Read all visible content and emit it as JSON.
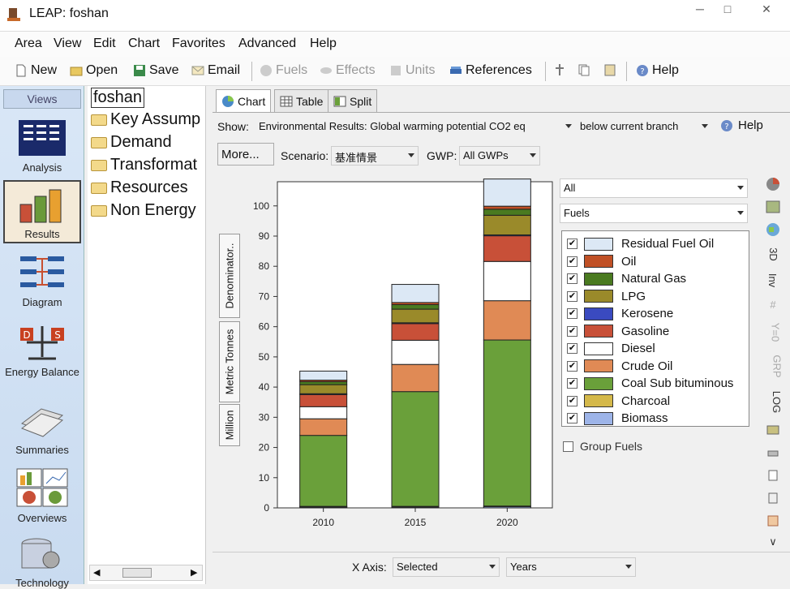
{
  "window": {
    "title": "LEAP: foshan"
  },
  "menu": [
    "Area",
    "View",
    "Edit",
    "Chart",
    "Favorites",
    "Advanced",
    "Help"
  ],
  "toolbar": {
    "new": "New",
    "open": "Open",
    "save": "Save",
    "email": "Email",
    "fuels": "Fuels",
    "effects": "Effects",
    "units": "Units",
    "references": "References",
    "help": "Help"
  },
  "views": {
    "header": "Views",
    "items": [
      "Analysis",
      "Results",
      "Diagram",
      "Energy Balance",
      "Summaries",
      "Overviews",
      "Technology"
    ]
  },
  "tree": {
    "root": "foshan",
    "items": [
      "Key Assump",
      "Demand",
      "Transformat",
      "Resources",
      "Non Energy"
    ]
  },
  "tabs": [
    "Chart",
    "Table",
    "Split"
  ],
  "controls": {
    "show_label": "Show:",
    "show_value": "Environmental Results: Global warming potential CO2 eq",
    "branch_value": "below current branch",
    "help": "Help",
    "more": "More...",
    "scenario_label": "Scenario:",
    "scenario_value": "基准情景",
    "gwp_label": "GWP:",
    "gwp_value": "All GWPs",
    "filter1": "All",
    "filter2": "Fuels",
    "group_fuels": "Group Fuels",
    "xaxis_label": "X Axis:",
    "xaxis_value": "Selected",
    "xaxis_dim": "Years"
  },
  "side_tabs": [
    "Denominator..",
    "Metric Tonnes",
    "Million"
  ],
  "right_tools": [
    "3D",
    "Inv",
    "Y=0",
    "GRP",
    "LOG"
  ],
  "chart_data": {
    "type": "bar",
    "stacked": true,
    "categories": [
      "2010",
      "2015",
      "2020"
    ],
    "ylim": [
      0,
      108
    ],
    "yticks": [
      0,
      10,
      20,
      30,
      40,
      50,
      60,
      70,
      80,
      90,
      100
    ],
    "series": [
      {
        "name": "Biomass",
        "color": "#9db4e8",
        "values": [
          0.3,
          0.3,
          0.4
        ]
      },
      {
        "name": "Charcoal",
        "color": "#d4b84a",
        "values": [
          0.2,
          0.2,
          0.2
        ]
      },
      {
        "name": "Coal Sub bituminous",
        "color": "#6aa03a",
        "values": [
          23.5,
          38.0,
          55.0
        ]
      },
      {
        "name": "Crude Oil",
        "color": "#e08a55",
        "values": [
          5.5,
          9.0,
          13.0
        ]
      },
      {
        "name": "Diesel",
        "color": "#ffffff",
        "values": [
          4.0,
          8.0,
          13.0
        ]
      },
      {
        "name": "Gasoline",
        "color": "#c85038",
        "values": [
          4.0,
          5.5,
          8.5
        ]
      },
      {
        "name": "Kerosene",
        "color": "#3a4ac0",
        "values": [
          0.3,
          0.3,
          0.3
        ]
      },
      {
        "name": "LPG",
        "color": "#9a8a2a",
        "values": [
          3.0,
          4.5,
          6.5
        ]
      },
      {
        "name": "Natural Gas",
        "color": "#4a7a20",
        "values": [
          1.0,
          1.5,
          2.0
        ]
      },
      {
        "name": "Oil",
        "color": "#c05025",
        "values": [
          0.5,
          0.7,
          1.0
        ]
      },
      {
        "name": "Residual Fuel Oil",
        "color": "#dce8f5",
        "values": [
          3.0,
          6.0,
          9.0
        ]
      }
    ],
    "legend_order": [
      "Residual Fuel Oil",
      "Oil",
      "Natural Gas",
      "LPG",
      "Kerosene",
      "Gasoline",
      "Diesel",
      "Crude Oil",
      "Coal Sub bituminous",
      "Charcoal",
      "Biomass"
    ]
  }
}
